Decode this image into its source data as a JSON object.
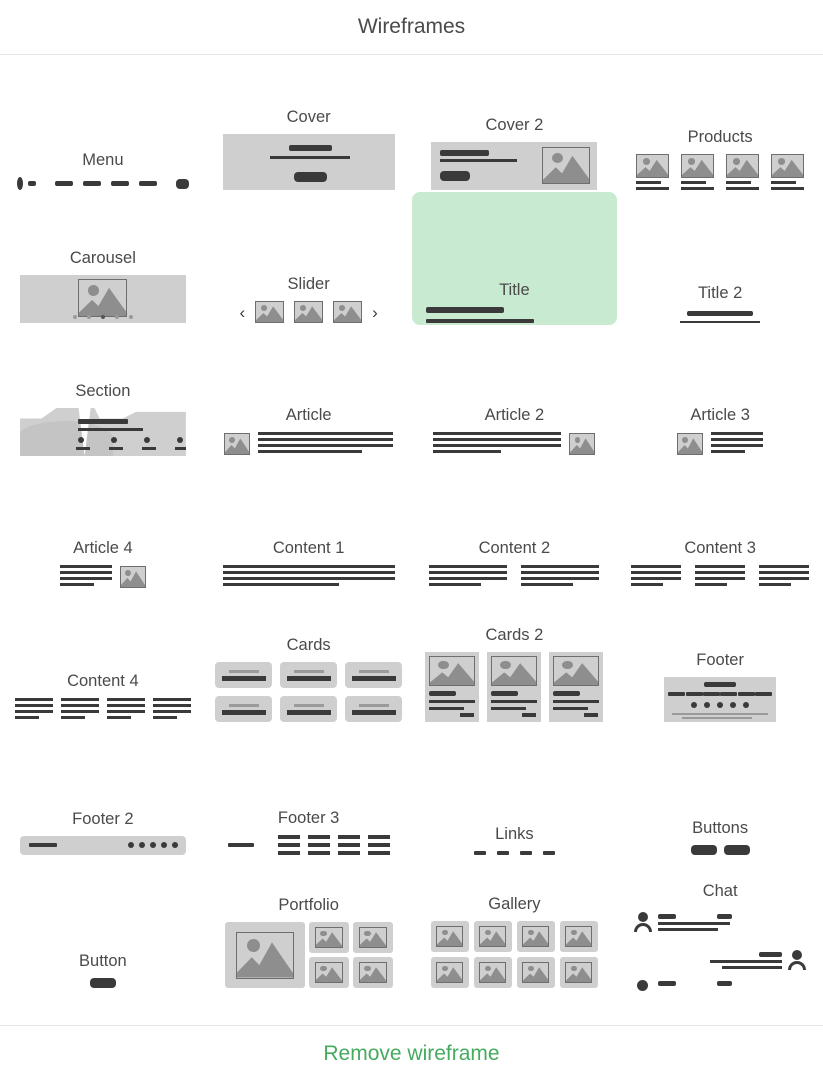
{
  "header": {
    "title": "Wireframes"
  },
  "footer": {
    "action_label": "Remove wireframe",
    "accent_color": "#46ab5f"
  },
  "theme": {
    "selected_background": "#c7ead0",
    "placeholder_fill": "#cfcfcf",
    "ink": "#3a3a3a",
    "label_color": "#4a4a4a"
  },
  "gallery": {
    "columns": 4,
    "rows": 8,
    "items": [
      {
        "label": "Menu",
        "kind": "menu",
        "selected": false
      },
      {
        "label": "Cover",
        "kind": "cover",
        "selected": false
      },
      {
        "label": "Cover 2",
        "kind": "cover2",
        "selected": false
      },
      {
        "label": "Products",
        "kind": "products",
        "selected": false
      },
      {
        "label": "Carousel",
        "kind": "carousel",
        "selected": false
      },
      {
        "label": "Slider",
        "kind": "slider",
        "selected": false
      },
      {
        "label": "Title",
        "kind": "title",
        "selected": true
      },
      {
        "label": "Title 2",
        "kind": "title2",
        "selected": false
      },
      {
        "label": "Section",
        "kind": "section",
        "selected": false
      },
      {
        "label": "Article",
        "kind": "article",
        "selected": false
      },
      {
        "label": "Article 2",
        "kind": "article2",
        "selected": false
      },
      {
        "label": "Article 3",
        "kind": "article3",
        "selected": false
      },
      {
        "label": "Article 4",
        "kind": "article4",
        "selected": false
      },
      {
        "label": "Content 1",
        "kind": "content1",
        "selected": false
      },
      {
        "label": "Content 2",
        "kind": "content2",
        "selected": false
      },
      {
        "label": "Content 3",
        "kind": "content3",
        "selected": false
      },
      {
        "label": "Content 4",
        "kind": "content4",
        "selected": false
      },
      {
        "label": "Cards",
        "kind": "cards",
        "selected": false
      },
      {
        "label": "Cards 2",
        "kind": "cards2",
        "selected": false
      },
      {
        "label": "Footer",
        "kind": "footer",
        "selected": false
      },
      {
        "label": "Footer 2",
        "kind": "footer2",
        "selected": false
      },
      {
        "label": "Footer 3",
        "kind": "footer3",
        "selected": false
      },
      {
        "label": "Links",
        "kind": "links",
        "selected": false
      },
      {
        "label": "Buttons",
        "kind": "buttons",
        "selected": false
      },
      {
        "label": "Button",
        "kind": "button",
        "selected": false
      },
      {
        "label": "Portfolio",
        "kind": "portfolio",
        "selected": false
      },
      {
        "label": "Gallery",
        "kind": "gallery",
        "selected": false
      },
      {
        "label": "Chat",
        "kind": "chat",
        "selected": false
      }
    ]
  },
  "icons": {
    "image_placeholder": "image-placeholder-icon",
    "prev_arrow": "‹",
    "next_arrow": "›",
    "person": "person-icon"
  },
  "counts": {
    "menu_dashes": 4,
    "products": 4,
    "carousel_dots": 5,
    "carousel_active_dot_index": 2,
    "slider_thumbs": 3,
    "section_bullets": 4,
    "cards": 6,
    "cards2": 3,
    "footer_nav_links": 6,
    "footer_social_dots": 5,
    "footer2_dots": 5,
    "footer3_columns": 4,
    "links": 4,
    "buttons": 2,
    "portfolio_small": 4,
    "gallery_tiles": 8,
    "chat_messages": 3
  }
}
